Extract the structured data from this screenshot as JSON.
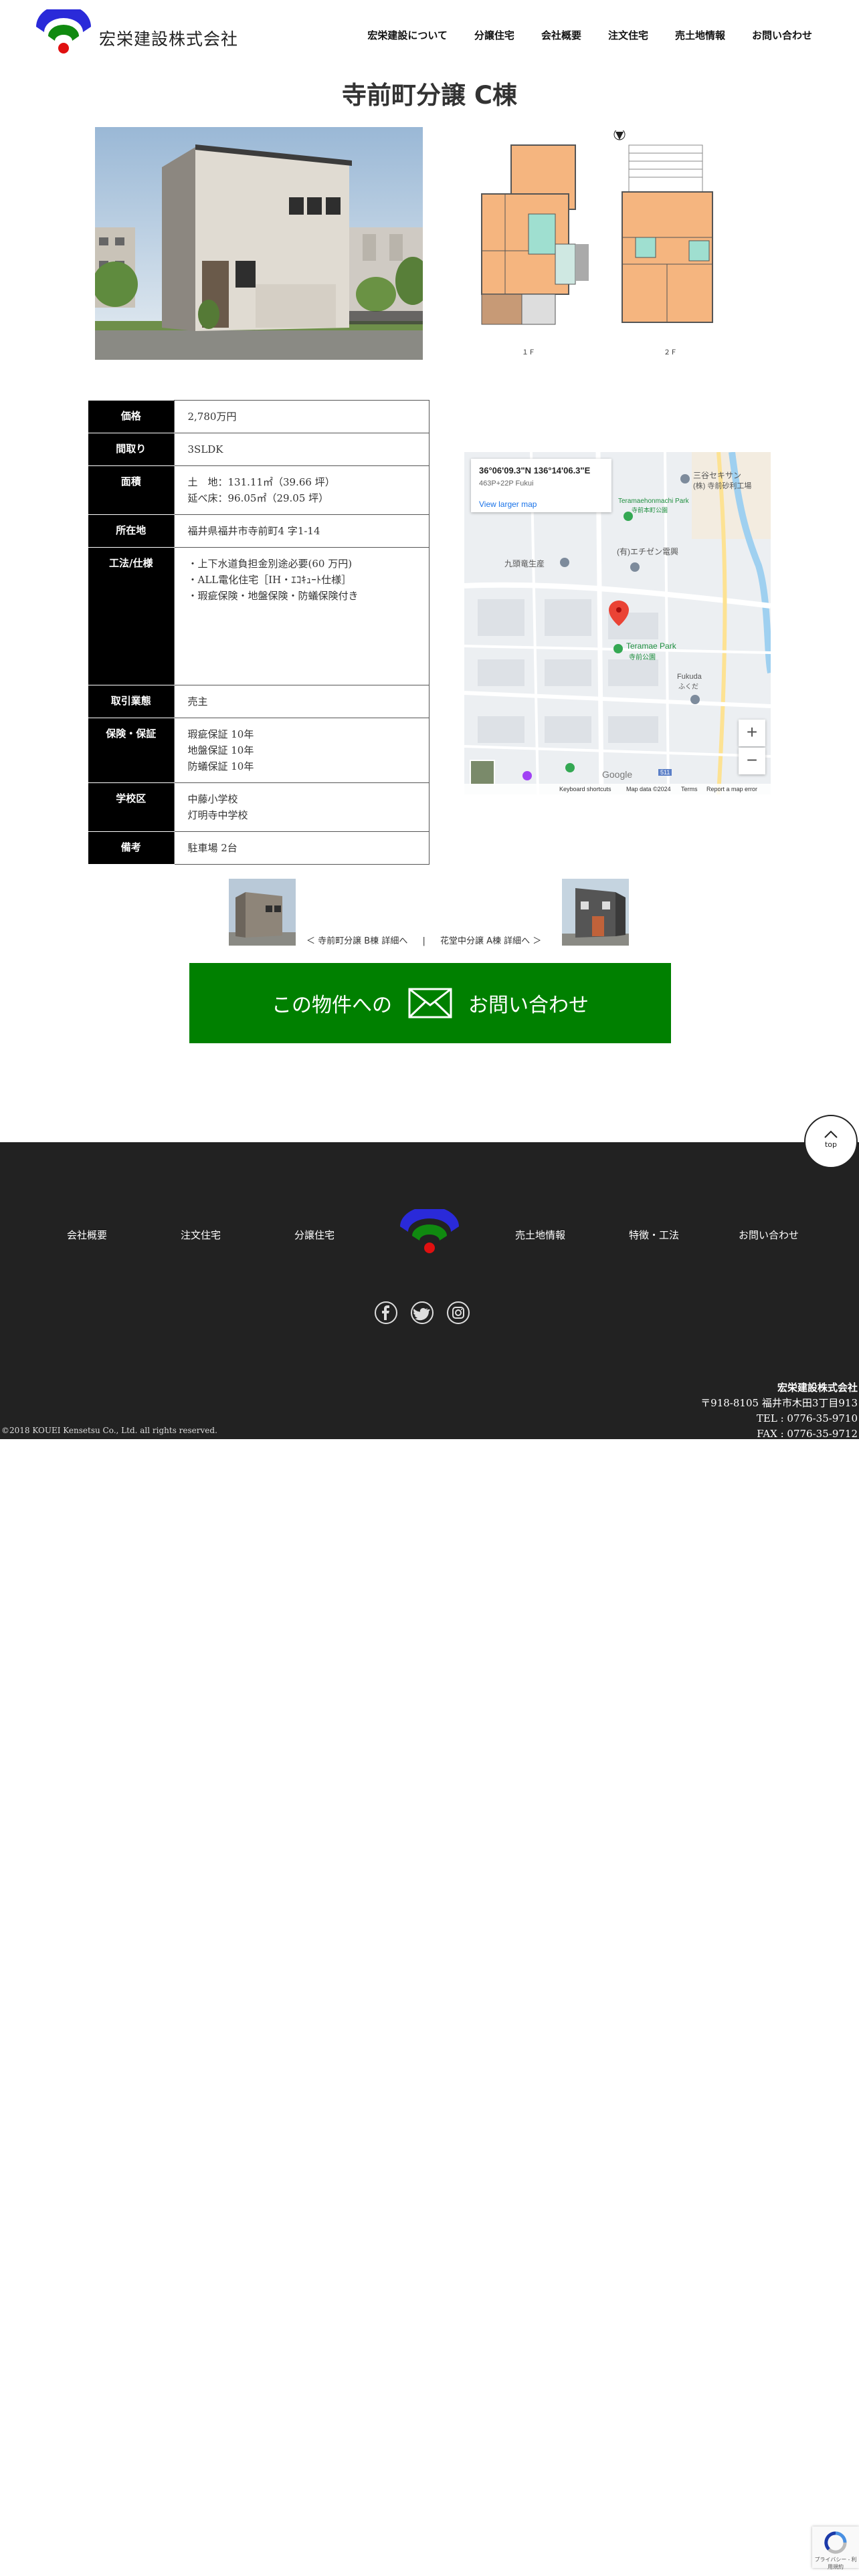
{
  "header": {
    "logo_text": "宏栄建設株式会社",
    "nav": [
      "宏栄建設について",
      "分譲住宅",
      "会社概要",
      "注文住宅",
      "売土地情報",
      "お問い合わせ"
    ]
  },
  "page_title": "寺前町分譲 C棟",
  "floorplan": {
    "label_1f": "１Ｆ",
    "label_2f": "２Ｆ"
  },
  "spec": {
    "price_label": "価格",
    "price": "2,780万円",
    "layout_label": "間取り",
    "layout": "3SLDK",
    "area_label": "面積",
    "area_land": "土　地：131.11㎡（39.66 坪）",
    "area_floor": "延べ床：96.05㎡（29.05 坪）",
    "address_label": "所在地",
    "address": "福井県福井市寺前町4 字1-14",
    "method_label": "工法/仕様",
    "method_1": "・上下水道負担金別途必要(60 万円)",
    "method_2": "・ALL電化住宅［IH・ｴｺｷｭｰﾄ仕様］",
    "method_3": "・瑕疵保険・地盤保険・防蟻保険付き",
    "deal_label": "取引業態",
    "deal": "売主",
    "warranty_label": "保険・保証",
    "warranty_1": "瑕疵保証 10年",
    "warranty_2": "地盤保証 10年",
    "warranty_3": "防蟻保証 10年",
    "school_label": "学校区",
    "school_1": "中藤小学校",
    "school_2": "灯明寺中学校",
    "note_label": "備考",
    "note": "駐車場 2台"
  },
  "map": {
    "coord": "36°06'09.3\"N 136°14'06.3\"E",
    "plus_code": "463P+22P Fukui",
    "larger": "View larger map",
    "labels": {
      "sanya1": "三谷セキサン",
      "sanya2": "(株) 寺前砂利工場",
      "park1": "Teramaehonmachi Park",
      "park1b": "寺前本町公園",
      "kudo": "九頭竜生産",
      "echizen": "(有)エチゼン電興",
      "park2": "Teramae Park",
      "park2b": "寺前公園",
      "fukuda": "Fukuda",
      "fukuda_jp": "ふくだ",
      "google": "Google",
      "road": "511"
    },
    "footer_keyboard": "Keyboard shortcuts",
    "footer_data": "Map data ©2024",
    "footer_terms": "Terms",
    "footer_report": "Report a map error"
  },
  "pager": {
    "prev": "＜ 寺前町分譲 B棟 詳細へ",
    "sep": "|",
    "next": "花堂中分譲 A棟 詳細へ ＞"
  },
  "contact": {
    "left": "この物件への",
    "right": "お問い合わせ"
  },
  "top_button": "top",
  "footer": {
    "nav": [
      "会社概要",
      "注文住宅",
      "分譲住宅",
      "売土地情報",
      "特徴・工法",
      "お問い合わせ"
    ],
    "company_name": "宏栄建設株式会社",
    "address": "〒918-8105 福井市木田3丁目913",
    "tel": "TEL : 0776-35-9710",
    "fax": "FAX : 0776-35-9712",
    "copyright": "©2018 KOUEI Kensetsu Co., Ltd. all rights reserved."
  },
  "recaptcha": "プライバシー - 利用規約"
}
